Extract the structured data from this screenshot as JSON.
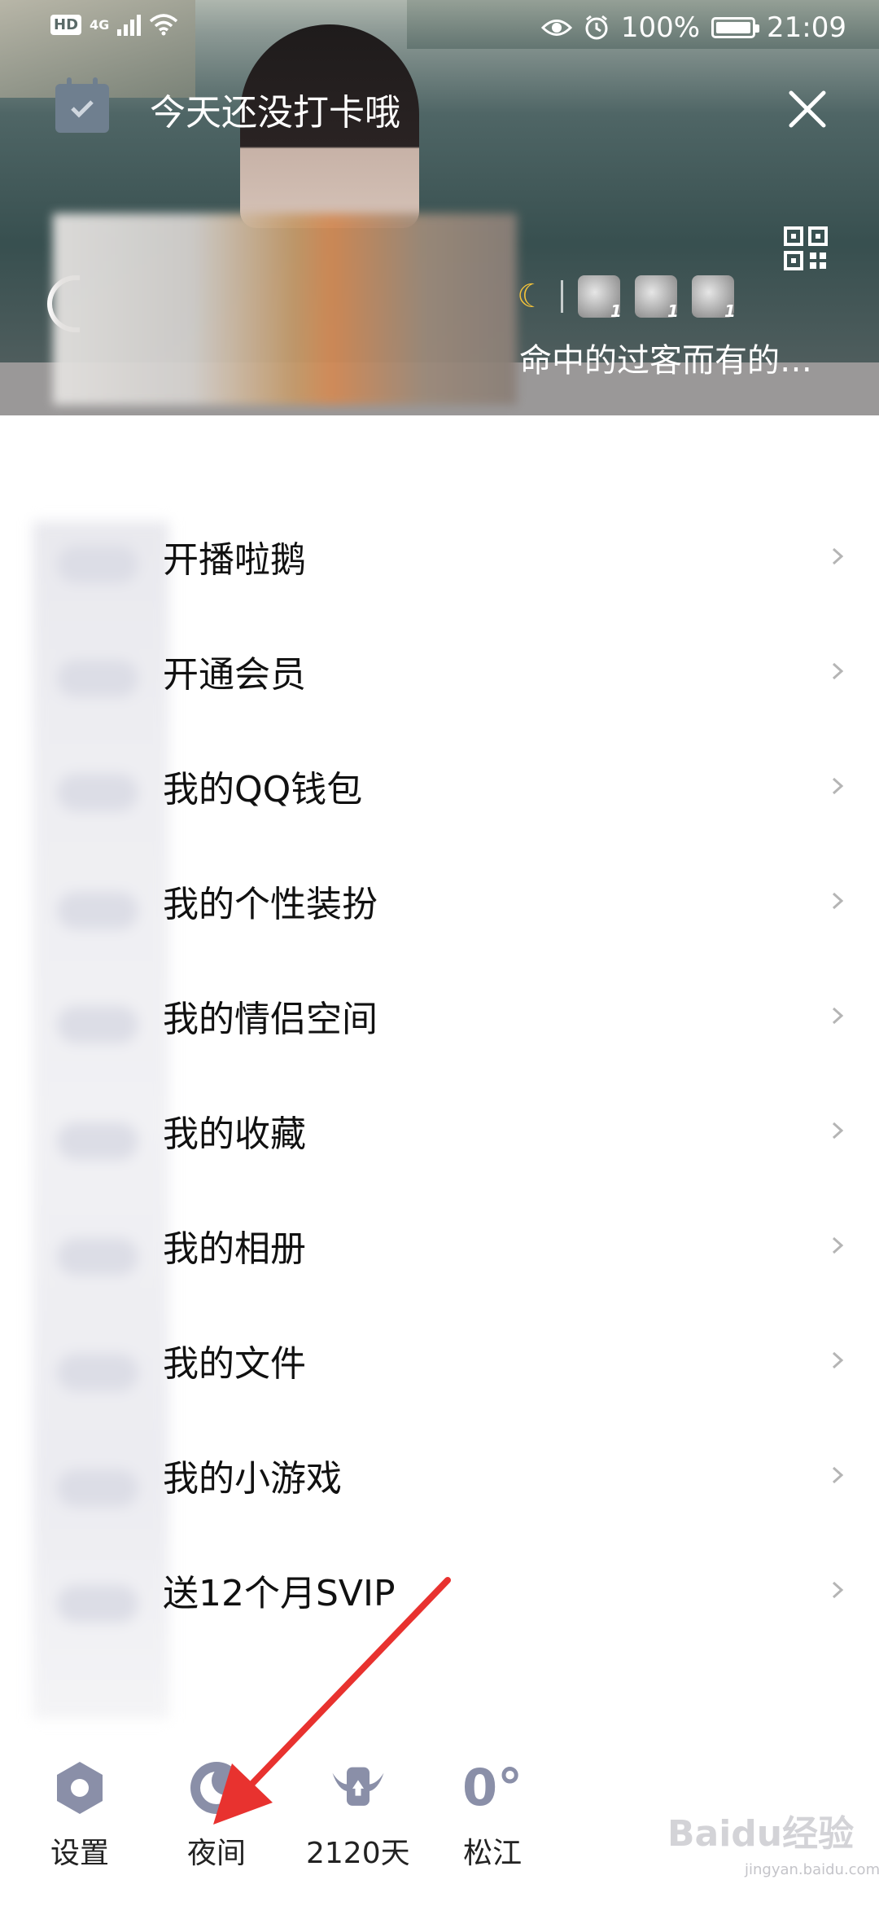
{
  "status_bar": {
    "hd": "HD",
    "network": "4G",
    "battery_percent": "100%",
    "time": "21:09"
  },
  "header": {
    "checkin_text": "今天还没打卡哦",
    "signature": "命中的过客而有的…",
    "badge_counts": [
      "1",
      "1",
      "1"
    ]
  },
  "menu": {
    "items": [
      {
        "label": "开播啦鹅"
      },
      {
        "label": "开通会员"
      },
      {
        "label": "我的QQ钱包"
      },
      {
        "label": "我的个性装扮"
      },
      {
        "label": "我的情侣空间"
      },
      {
        "label": "我的收藏"
      },
      {
        "label": "我的相册"
      },
      {
        "label": "我的文件"
      },
      {
        "label": "我的小游戏"
      },
      {
        "label": "送12个月SVIP"
      }
    ]
  },
  "bottom_bar": {
    "settings_label": "设置",
    "night_label": "夜间",
    "days_label": "2120天",
    "temperature": "0°",
    "city_label": "松江"
  },
  "watermark": {
    "brand": "Baidu经验",
    "url": "jingyan.baidu.com"
  },
  "colors": {
    "icon_gray": "#8a8fa8",
    "arrow_red": "#e8322f",
    "chevron": "#b5b5b5"
  }
}
